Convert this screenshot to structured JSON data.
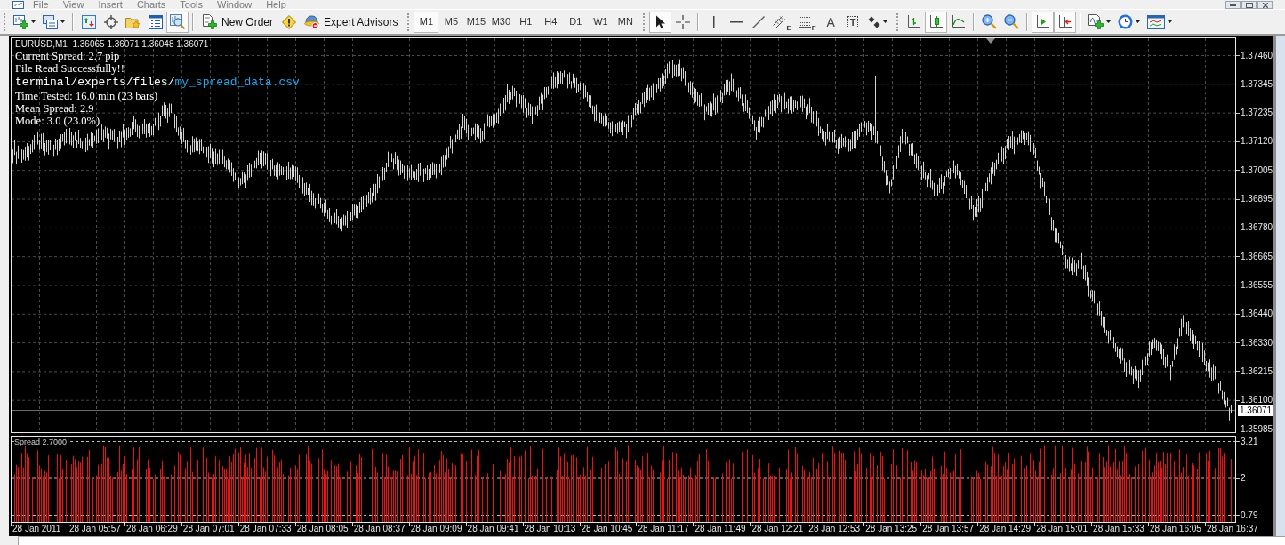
{
  "menu_bar": {
    "items": [
      "File",
      "View",
      "Insert",
      "Charts",
      "Tools",
      "Window",
      "Help"
    ]
  },
  "toolbars": [
    {
      "items": [
        {
          "kind": "new_chart",
          "pressed": false
        },
        {
          "kind": "profiles",
          "pressed": false
        },
        {
          "kind": "separator"
        },
        {
          "kind": "market_watch",
          "pressed": false
        },
        {
          "kind": "data_window",
          "pressed": false
        },
        {
          "kind": "navigator",
          "pressed": false
        },
        {
          "kind": "terminal",
          "pressed": false
        },
        {
          "kind": "strategy_tester",
          "pressed": true
        },
        {
          "kind": "separator"
        },
        {
          "kind": "new_order",
          "label": "New Order",
          "pressed": false
        },
        {
          "kind": "warning",
          "pressed": false
        },
        {
          "kind": "expert_advisors",
          "label": "Expert Advisors",
          "pressed": false
        }
      ]
    },
    {
      "items": [
        {
          "kind": "timeframe",
          "label": "M1",
          "selected": true
        },
        {
          "kind": "timeframe",
          "label": "M5",
          "selected": false
        },
        {
          "kind": "timeframe",
          "label": "M15",
          "selected": false
        },
        {
          "kind": "timeframe",
          "label": "M30",
          "selected": false
        },
        {
          "kind": "timeframe",
          "label": "H1",
          "selected": false
        },
        {
          "kind": "timeframe",
          "label": "H4",
          "selected": false
        },
        {
          "kind": "timeframe",
          "label": "D1",
          "selected": false
        },
        {
          "kind": "timeframe",
          "label": "W1",
          "selected": false
        },
        {
          "kind": "timeframe",
          "label": "MN",
          "selected": false
        }
      ]
    },
    {
      "items": [
        {
          "kind": "cursor",
          "pressed": true
        },
        {
          "kind": "crosshair",
          "pressed": false
        },
        {
          "kind": "separator"
        },
        {
          "kind": "vertical_line",
          "pressed": false
        },
        {
          "kind": "horizontal_line",
          "pressed": false
        },
        {
          "kind": "trendline",
          "pressed": false
        },
        {
          "kind": "channel",
          "glyph": "E",
          "pressed": false
        },
        {
          "kind": "fibonacci",
          "glyph": "F",
          "pressed": false
        },
        {
          "kind": "text",
          "glyph": "A",
          "pressed": false
        },
        {
          "kind": "text_label",
          "glyph": "T",
          "pressed": false
        },
        {
          "kind": "arrows",
          "pressed": false
        }
      ]
    },
    {
      "items": [
        {
          "kind": "bar_chart",
          "pressed": false
        },
        {
          "kind": "candlesticks",
          "pressed": true
        },
        {
          "kind": "line_chart",
          "pressed": false
        },
        {
          "kind": "separator"
        },
        {
          "kind": "zoom_in",
          "pressed": false
        },
        {
          "kind": "zoom_out",
          "pressed": false
        },
        {
          "kind": "separator"
        },
        {
          "kind": "chart_shift",
          "pressed": true
        },
        {
          "kind": "auto_scroll",
          "pressed": true
        },
        {
          "kind": "separator"
        },
        {
          "kind": "indicators",
          "pressed": false
        },
        {
          "kind": "periods",
          "pressed": false
        },
        {
          "kind": "templates",
          "pressed": false
        }
      ]
    }
  ],
  "chart": {
    "header": "EURUSD,M1  1.36065 1.36071 1.36048 1.36071",
    "comments": [
      {
        "kind": "text",
        "text": "Current Spread: 2.7 pip"
      },
      {
        "kind": "text",
        "text": "File Read Successfully!!"
      },
      {
        "kind": "path",
        "folder": "terminal/experts/files/",
        "file": "my_spread_data.csv"
      },
      {
        "kind": "text",
        "text": "Time Tested: 16.0 min (23 bars)"
      },
      {
        "kind": "text",
        "text": "Mean Spread: 2.9"
      },
      {
        "kind": "text",
        "text": "Mode: 3.0 (23.0%)"
      }
    ],
    "price_axis": [
      "1.37460",
      "1.37345",
      "1.37235",
      "1.37120",
      "1.37005",
      "1.36895",
      "1.36780",
      "1.36665",
      "1.36555",
      "1.36440",
      "1.36330",
      "1.36215",
      "1.36100",
      "1.35985"
    ],
    "current_price": "1.36071",
    "indicator": {
      "label": "Spread 2.7000",
      "axis": [
        "3.21",
        "2",
        "0.79"
      ]
    },
    "time_axis": [
      "28 Jan 2011",
      "28 Jan 05:57",
      "28 Jan 06:29",
      "28 Jan 07:01",
      "28 Jan 07:33",
      "28 Jan 08:05",
      "28 Jan 08:37",
      "28 Jan 09:09",
      "28 Jan 09:41",
      "28 Jan 10:13",
      "28 Jan 10:45",
      "28 Jan 11:17",
      "28 Jan 11:49",
      "28 Jan 12:21",
      "28 Jan 12:53",
      "28 Jan 13:25",
      "28 Jan 13:57",
      "28 Jan 14:29",
      "28 Jan 15:01",
      "28 Jan 15:33",
      "28 Jan 16:05",
      "28 Jan 16:37"
    ]
  }
}
